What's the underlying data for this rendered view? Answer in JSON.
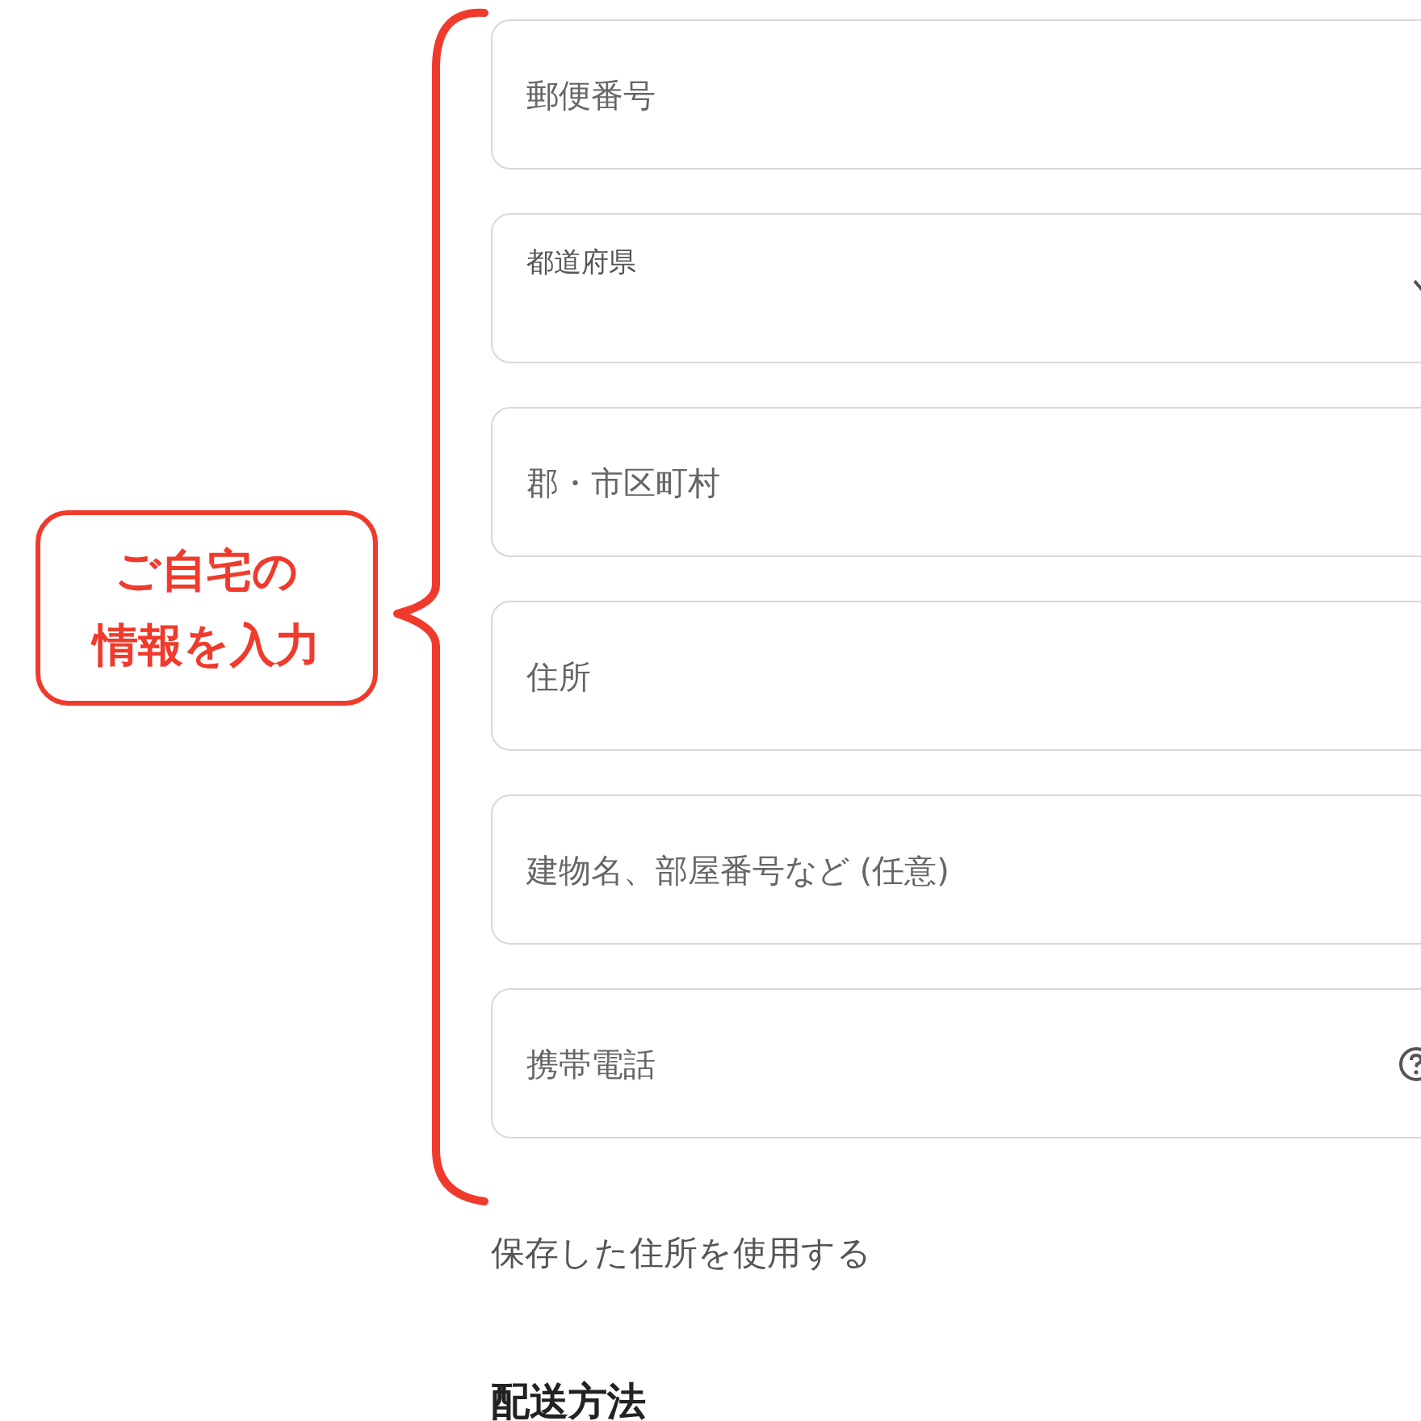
{
  "annotation": {
    "lines": [
      "ご自宅の",
      "情報を入力"
    ]
  },
  "fields": [
    {
      "kind": "text",
      "placeholder": "郵便番号"
    },
    {
      "kind": "select",
      "label": "都道府県"
    },
    {
      "kind": "text",
      "placeholder": "郡・市区町村"
    },
    {
      "kind": "text",
      "placeholder": "住所"
    },
    {
      "kind": "text",
      "placeholder": "建物名、部屋番号など (任意)"
    },
    {
      "kind": "help",
      "placeholder": "携帯電話"
    }
  ],
  "saved_address_link": "保存した住所を使用する",
  "section_heading": "配送方法"
}
